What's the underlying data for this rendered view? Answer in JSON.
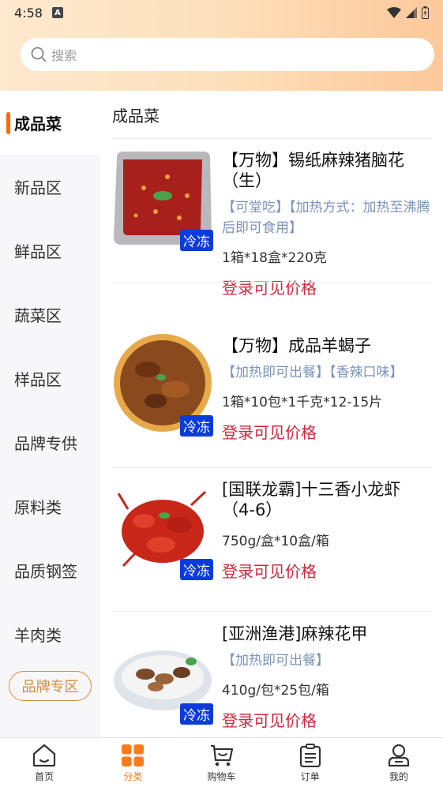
{
  "status": {
    "time": "4:58",
    "indicator": "A"
  },
  "search": {
    "placeholder": "搜索"
  },
  "sidebar": {
    "items": [
      {
        "label": "成品菜"
      },
      {
        "label": "新品区"
      },
      {
        "label": "鲜品区"
      },
      {
        "label": "蔬菜区"
      },
      {
        "label": "样品区"
      },
      {
        "label": "品牌专供"
      },
      {
        "label": "原料类"
      },
      {
        "label": "品质钢签"
      },
      {
        "label": "羊肉类"
      }
    ],
    "brand_button": "品牌专区"
  },
  "content": {
    "title": "成品菜",
    "products": [
      {
        "name": "【万物】锡纸麻辣猪脑花（生）",
        "tags": "【可堂吃】【加热方式：加热至沸腾后即可食用】",
        "spec": "1箱*18盒*220克",
        "price": "登录可见价格",
        "badge": "冷冻"
      },
      {
        "name": "【万物】成品羊蝎子",
        "tags": "【加热即可出餐】【香辣口味】",
        "spec": "1箱*10包*1千克*12-15片",
        "price": "登录可见价格",
        "badge": "冷冻"
      },
      {
        "name": "[国联龙霸]十三香小龙虾（4-6）",
        "tags": "",
        "spec": "750g/盒*10盒/箱",
        "price": "登录可见价格",
        "badge": "冷冻"
      },
      {
        "name": "[亚洲渔港]麻辣花甲",
        "tags": "【加热即可出餐】",
        "spec": "410g/包*25包/箱",
        "price": "登录可见价格",
        "badge": "冷冻"
      }
    ]
  },
  "tabbar": {
    "tabs": [
      {
        "label": "首页",
        "icon": "home-icon"
      },
      {
        "label": "分类",
        "icon": "category-icon"
      },
      {
        "label": "购物车",
        "icon": "cart-icon"
      },
      {
        "label": "订单",
        "icon": "order-icon"
      },
      {
        "label": "我的",
        "icon": "profile-icon"
      }
    ]
  },
  "colors": {
    "accent": "#ff7a1a",
    "price": "#d3263d",
    "frozen_badge": "#0b3bdc",
    "brand": "#d88a3a"
  }
}
